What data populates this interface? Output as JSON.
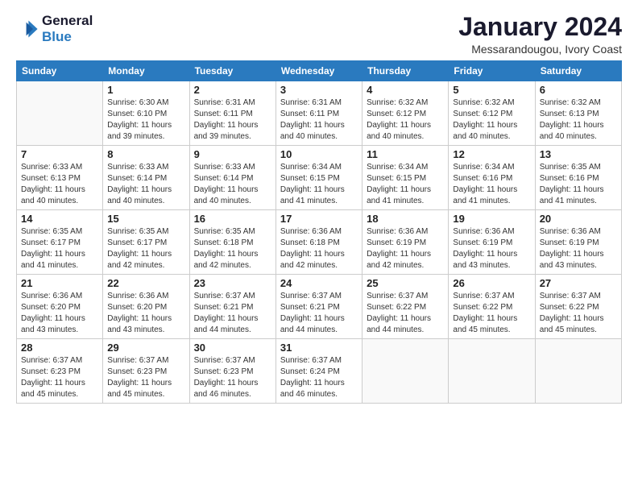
{
  "header": {
    "logo_line1": "General",
    "logo_line2": "Blue",
    "month_title": "January 2024",
    "location": "Messarandougou, Ivory Coast"
  },
  "weekdays": [
    "Sunday",
    "Monday",
    "Tuesday",
    "Wednesday",
    "Thursday",
    "Friday",
    "Saturday"
  ],
  "weeks": [
    [
      {
        "day": "",
        "detail": ""
      },
      {
        "day": "1",
        "detail": "Sunrise: 6:30 AM\nSunset: 6:10 PM\nDaylight: 11 hours\nand 39 minutes."
      },
      {
        "day": "2",
        "detail": "Sunrise: 6:31 AM\nSunset: 6:11 PM\nDaylight: 11 hours\nand 39 minutes."
      },
      {
        "day": "3",
        "detail": "Sunrise: 6:31 AM\nSunset: 6:11 PM\nDaylight: 11 hours\nand 40 minutes."
      },
      {
        "day": "4",
        "detail": "Sunrise: 6:32 AM\nSunset: 6:12 PM\nDaylight: 11 hours\nand 40 minutes."
      },
      {
        "day": "5",
        "detail": "Sunrise: 6:32 AM\nSunset: 6:12 PM\nDaylight: 11 hours\nand 40 minutes."
      },
      {
        "day": "6",
        "detail": "Sunrise: 6:32 AM\nSunset: 6:13 PM\nDaylight: 11 hours\nand 40 minutes."
      }
    ],
    [
      {
        "day": "7",
        "detail": "Sunrise: 6:33 AM\nSunset: 6:13 PM\nDaylight: 11 hours\nand 40 minutes."
      },
      {
        "day": "8",
        "detail": "Sunrise: 6:33 AM\nSunset: 6:14 PM\nDaylight: 11 hours\nand 40 minutes."
      },
      {
        "day": "9",
        "detail": "Sunrise: 6:33 AM\nSunset: 6:14 PM\nDaylight: 11 hours\nand 40 minutes."
      },
      {
        "day": "10",
        "detail": "Sunrise: 6:34 AM\nSunset: 6:15 PM\nDaylight: 11 hours\nand 41 minutes."
      },
      {
        "day": "11",
        "detail": "Sunrise: 6:34 AM\nSunset: 6:15 PM\nDaylight: 11 hours\nand 41 minutes."
      },
      {
        "day": "12",
        "detail": "Sunrise: 6:34 AM\nSunset: 6:16 PM\nDaylight: 11 hours\nand 41 minutes."
      },
      {
        "day": "13",
        "detail": "Sunrise: 6:35 AM\nSunset: 6:16 PM\nDaylight: 11 hours\nand 41 minutes."
      }
    ],
    [
      {
        "day": "14",
        "detail": "Sunrise: 6:35 AM\nSunset: 6:17 PM\nDaylight: 11 hours\nand 41 minutes."
      },
      {
        "day": "15",
        "detail": "Sunrise: 6:35 AM\nSunset: 6:17 PM\nDaylight: 11 hours\nand 42 minutes."
      },
      {
        "day": "16",
        "detail": "Sunrise: 6:35 AM\nSunset: 6:18 PM\nDaylight: 11 hours\nand 42 minutes."
      },
      {
        "day": "17",
        "detail": "Sunrise: 6:36 AM\nSunset: 6:18 PM\nDaylight: 11 hours\nand 42 minutes."
      },
      {
        "day": "18",
        "detail": "Sunrise: 6:36 AM\nSunset: 6:19 PM\nDaylight: 11 hours\nand 42 minutes."
      },
      {
        "day": "19",
        "detail": "Sunrise: 6:36 AM\nSunset: 6:19 PM\nDaylight: 11 hours\nand 43 minutes."
      },
      {
        "day": "20",
        "detail": "Sunrise: 6:36 AM\nSunset: 6:19 PM\nDaylight: 11 hours\nand 43 minutes."
      }
    ],
    [
      {
        "day": "21",
        "detail": "Sunrise: 6:36 AM\nSunset: 6:20 PM\nDaylight: 11 hours\nand 43 minutes."
      },
      {
        "day": "22",
        "detail": "Sunrise: 6:36 AM\nSunset: 6:20 PM\nDaylight: 11 hours\nand 43 minutes."
      },
      {
        "day": "23",
        "detail": "Sunrise: 6:37 AM\nSunset: 6:21 PM\nDaylight: 11 hours\nand 44 minutes."
      },
      {
        "day": "24",
        "detail": "Sunrise: 6:37 AM\nSunset: 6:21 PM\nDaylight: 11 hours\nand 44 minutes."
      },
      {
        "day": "25",
        "detail": "Sunrise: 6:37 AM\nSunset: 6:22 PM\nDaylight: 11 hours\nand 44 minutes."
      },
      {
        "day": "26",
        "detail": "Sunrise: 6:37 AM\nSunset: 6:22 PM\nDaylight: 11 hours\nand 45 minutes."
      },
      {
        "day": "27",
        "detail": "Sunrise: 6:37 AM\nSunset: 6:22 PM\nDaylight: 11 hours\nand 45 minutes."
      }
    ],
    [
      {
        "day": "28",
        "detail": "Sunrise: 6:37 AM\nSunset: 6:23 PM\nDaylight: 11 hours\nand 45 minutes."
      },
      {
        "day": "29",
        "detail": "Sunrise: 6:37 AM\nSunset: 6:23 PM\nDaylight: 11 hours\nand 45 minutes."
      },
      {
        "day": "30",
        "detail": "Sunrise: 6:37 AM\nSunset: 6:23 PM\nDaylight: 11 hours\nand 46 minutes."
      },
      {
        "day": "31",
        "detail": "Sunrise: 6:37 AM\nSunset: 6:24 PM\nDaylight: 11 hours\nand 46 minutes."
      },
      {
        "day": "",
        "detail": ""
      },
      {
        "day": "",
        "detail": ""
      },
      {
        "day": "",
        "detail": ""
      }
    ]
  ]
}
